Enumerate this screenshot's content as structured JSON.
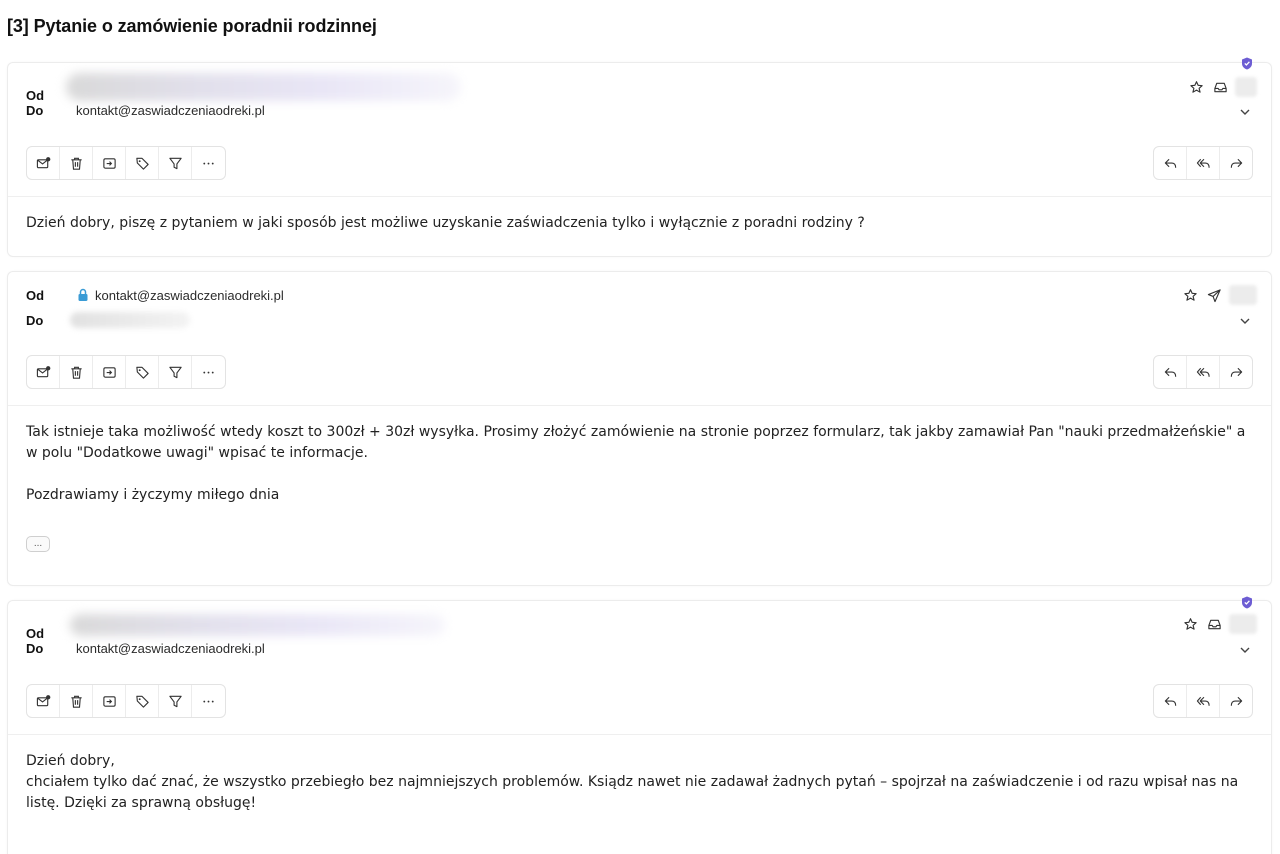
{
  "thread": {
    "title": "[3] Pytanie o zamówienie poradnii rodzinnej"
  },
  "labels": {
    "from": "Od",
    "to": "Do"
  },
  "toolbar_icons": [
    "mark-unread-icon",
    "trash-icon",
    "move-icon",
    "tag-icon",
    "filter-icon",
    "more-icon"
  ],
  "reply_icons": [
    "reply-icon",
    "reply-all-icon",
    "forward-icon"
  ],
  "colors": {
    "accent": "#6d5dd3",
    "lock": "#3a9bd5",
    "border": "#e3e3e3"
  },
  "messages": [
    {
      "from": "",
      "to": "kontakt@zaswiadczeniaodreki.pl",
      "body": [
        "Dzień dobry, piszę z pytaniem w jaki sposób jest możliwe uzyskanie zaświadczenia tylko i wyłącznie z poradni rodziny ?"
      ]
    },
    {
      "from": "kontakt@zaswiadczeniaodreki.pl",
      "to": "",
      "body": [
        "Tak istnieje taka możliwość wtedy koszt to 300zł + 30zł wysyłka. Prosimy złożyć zamówienie na stronie poprzez formularz, tak jakby zamawiał Pan \"nauki przedmałżeńskie\" a w polu \"Dodatkowe uwagi\" wpisać te informacje.",
        "Pozdrawiamy i życzymy miłego dnia"
      ],
      "more_label": "..."
    },
    {
      "from": "",
      "to": "kontakt@zaswiadczeniaodreki.pl",
      "body": [
        "Dzień dobry,",
        "chciałem tylko dać znać, że wszystko przebiegło bez najmniejszych problemów. Ksiądz nawet nie zadawał żadnych pytań – spojrzał na zaświadczenie i od razu wpisał nas na listę. Dzięki za sprawną obsługę!"
      ]
    }
  ]
}
